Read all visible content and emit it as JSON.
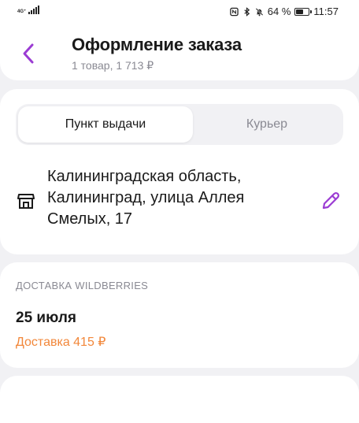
{
  "status_bar": {
    "network_top": "4G⁺",
    "network_bottom": "⁴⁶",
    "battery_percent": "64 %",
    "battery_level": 0.64,
    "time": "11:57"
  },
  "header": {
    "title": "Оформление заказа",
    "subtitle": "1 товар, 1 713 ₽",
    "back_icon": "chevron-left-icon"
  },
  "delivery_method": {
    "options": [
      {
        "label": "Пункт выдачи",
        "selected": true
      },
      {
        "label": "Курьер",
        "selected": false
      }
    ]
  },
  "pickup_point": {
    "icon": "store-icon",
    "address": "Калининградская область, Калининград, улица Аллея Смелых, 17",
    "edit_icon": "pencil-icon"
  },
  "shipping": {
    "label": "Доставка Wildberries",
    "date": "25 июля",
    "price": "Доставка 415 ₽"
  },
  "colors": {
    "accent": "#9b3cd3",
    "price_orange": "#f2873a",
    "background": "#f1f1f4",
    "card": "#ffffff",
    "muted_text": "#8a8a93"
  }
}
